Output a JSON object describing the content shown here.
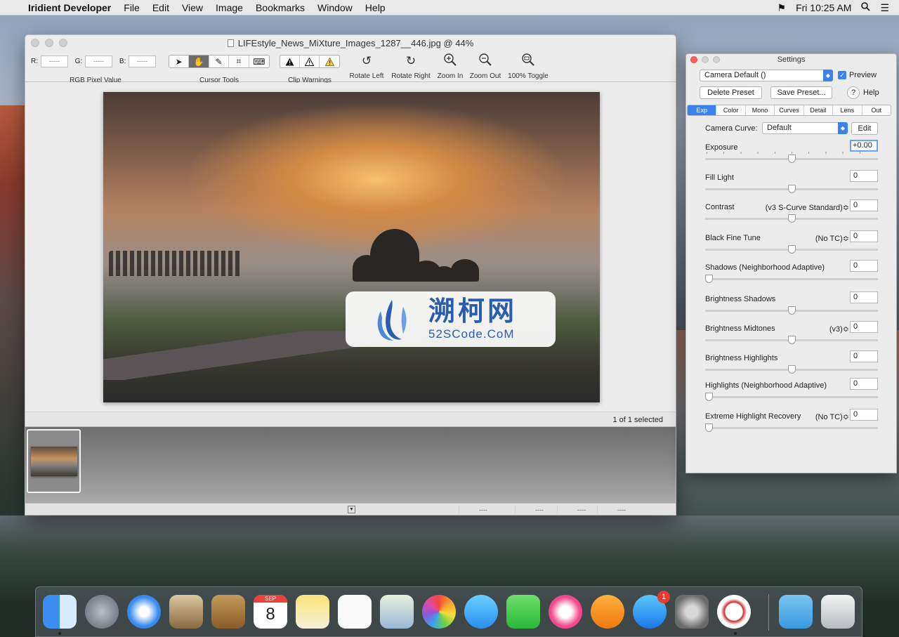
{
  "menubar": {
    "app_name": "Iridient Developer",
    "items": [
      "File",
      "Edit",
      "View",
      "Image",
      "Bookmarks",
      "Window",
      "Help"
    ],
    "clock": "Fri 10:25 AM"
  },
  "main_window": {
    "title": "LIFEstyle_News_MiXture_Images_1287__446.jpg @ 44%",
    "toolbar": {
      "rgb": {
        "r_label": "R:",
        "r_value": "-----",
        "g_label": "G:",
        "g_value": "-----",
        "b_label": "B:",
        "b_value": "-----",
        "group_label": "RGB Pixel Value"
      },
      "cursor_tools_label": "Cursor Tools",
      "clip_warnings_label": "Clip Warnings",
      "rotate_left": "Rotate Left",
      "rotate_right": "Rotate Right",
      "zoom_in": "Zoom In",
      "zoom_out": "Zoom Out",
      "toggle_100": "100% Toggle"
    },
    "watermark": {
      "cn": "溯柯网",
      "en": "52SCode.CoM"
    },
    "status": "1 of 1 selected",
    "bottom_cells": [
      "----",
      "----",
      "----",
      "----"
    ]
  },
  "settings": {
    "title": "Settings",
    "preset": "Camera Default ()",
    "preview_label": "Preview",
    "delete_preset": "Delete Preset",
    "save_preset": "Save Preset...",
    "help": "Help",
    "tabs": [
      "Exp",
      "Color",
      "Mono",
      "Curves",
      "Detail",
      "Lens",
      "Out"
    ],
    "camera_curve_label": "Camera Curve:",
    "camera_curve_value": "Default",
    "edit_label": "Edit",
    "rows": [
      {
        "label": "Exposure",
        "mode": "",
        "value": "+0.00"
      },
      {
        "label": "Fill Light",
        "mode": "",
        "value": "0"
      },
      {
        "label": "Contrast",
        "mode": "(v3 S-Curve Standard)≎",
        "value": "0"
      },
      {
        "label": "Black Fine Tune",
        "mode": "(No TC)≎",
        "value": "0"
      },
      {
        "label": "Shadows (Neighborhood Adaptive)",
        "mode": "",
        "value": "0"
      },
      {
        "label": "Brightness Shadows",
        "mode": "",
        "value": "0"
      },
      {
        "label": "Brightness Midtones",
        "mode": "(v3)≎",
        "value": "0"
      },
      {
        "label": "Brightness Highlights",
        "mode": "",
        "value": "0"
      },
      {
        "label": "Highlights (Neighborhood Adaptive)",
        "mode": "",
        "value": "0"
      },
      {
        "label": "Extreme Highlight Recovery",
        "mode": "(No TC)≎",
        "value": "0"
      }
    ]
  },
  "dock": {
    "calendar_month": "SEP",
    "calendar_day": "8",
    "appstore_badge": "1"
  }
}
